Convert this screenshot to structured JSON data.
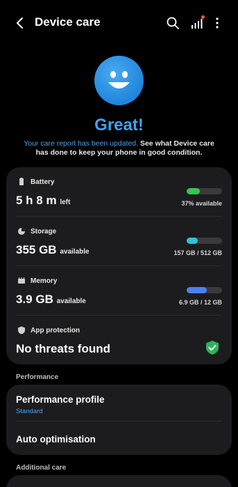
{
  "header": {
    "title": "Device care",
    "icons": [
      "back-arrow-icon",
      "search-icon",
      "signal-stats-icon",
      "more-vertical-icon"
    ],
    "notification_dot_color": "#f0564a"
  },
  "hero": {
    "heading": "Great!",
    "report_link": "Your care report has been updated.",
    "report_text": " See what Device care has done to keep your phone in good condition."
  },
  "stats": {
    "battery": {
      "label": "Battery",
      "value": "5 h 8 m",
      "suffix": "left",
      "bar_fraction": 0.37,
      "bar_color": "#33c553",
      "detail": "37% available"
    },
    "storage": {
      "label": "Storage",
      "value": "355 GB",
      "suffix": "available",
      "bar_fraction": 0.31,
      "bar_color": "#2ec2d6",
      "detail": "157 GB / 512 GB"
    },
    "memory": {
      "label": "Memory",
      "value": "3.9 GB",
      "suffix": "available",
      "bar_fraction": 0.575,
      "bar_color": "#4a82f5",
      "detail": "6.9 GB / 12 GB"
    },
    "protection": {
      "label": "App protection",
      "value": "No threats found",
      "status_color": "#2fb35a"
    }
  },
  "performance": {
    "section_label": "Performance",
    "profile_title": "Performance profile",
    "profile_value": "Standard",
    "auto_label": "Auto optimisation"
  },
  "additional": {
    "section_label": "Additional care"
  },
  "colors": {
    "accent": "#3ea2ee",
    "card_bg": "#1c1c1e"
  }
}
